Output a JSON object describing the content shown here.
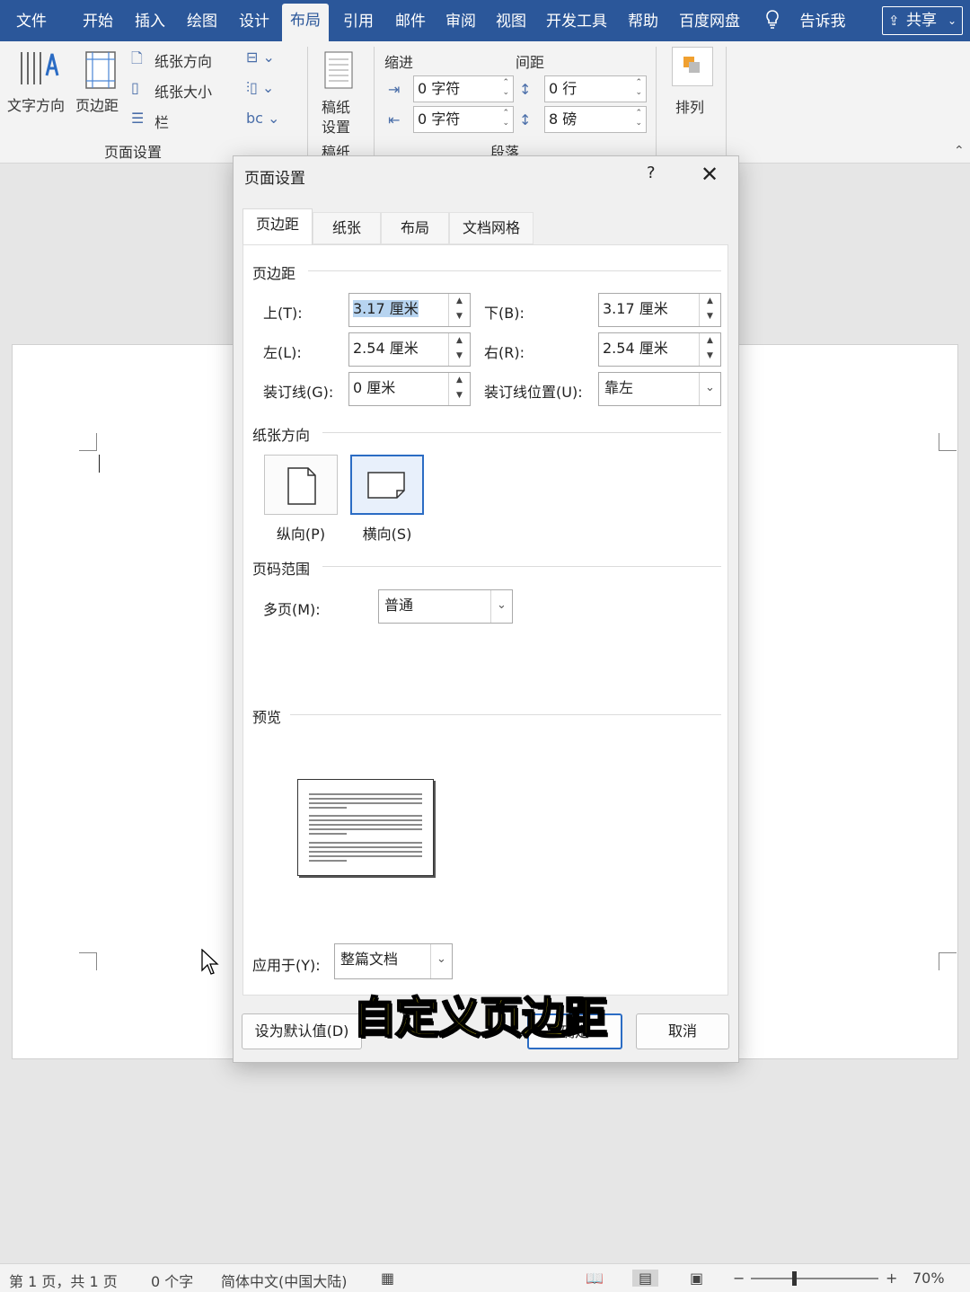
{
  "tabs": [
    "文件",
    "开始",
    "插入",
    "绘图",
    "设计",
    "布局",
    "引用",
    "邮件",
    "审阅",
    "视图",
    "开发工具",
    "帮助",
    "百度网盘"
  ],
  "active_tab": "布局",
  "tell_me": "告诉我",
  "share_label": "共享",
  "ribbon": {
    "text_direction": "文字方向",
    "margins": "页边距",
    "orientation": "纸张方向",
    "size": "纸张大小",
    "columns": "栏",
    "page_setup_group": "页面设置",
    "manuscript_line1": "稿纸",
    "manuscript_line2": "设置",
    "manuscript_group": "稿纸",
    "indent_header": "缩进",
    "spacing_header": "间距",
    "indent_left": "0 字符",
    "indent_right": "0 字符",
    "spacing_before": "0 行",
    "spacing_after": "8 磅",
    "paragraph_group": "段落",
    "arrange": "排列"
  },
  "dialog": {
    "title": "页面设置",
    "help": "?",
    "tabs": [
      "页边距",
      "纸张",
      "布局",
      "文档网格"
    ],
    "margins_section": "页边距",
    "top_label": "上(T):",
    "top_value": "3.17 厘米",
    "bottom_label": "下(B):",
    "bottom_value": "3.17 厘米",
    "left_label": "左(L):",
    "left_value": "2.54 厘米",
    "right_label": "右(R):",
    "right_value": "2.54 厘米",
    "gutter_label": "装订线(G):",
    "gutter_value": "0 厘米",
    "gutter_pos_label": "装订线位置(U):",
    "gutter_pos_value": "靠左",
    "orientation_section": "纸张方向",
    "portrait": "纵向(P)",
    "landscape": "横向(S)",
    "pages_section": "页码范围",
    "multiple_pages_label": "多页(M):",
    "multiple_pages_value": "普通",
    "preview_section": "预览",
    "apply_label": "应用于(Y):",
    "apply_value": "整篇文档",
    "set_default": "设为默认值(D)",
    "ok": "确定",
    "cancel": "取消"
  },
  "caption": "自定义页边距",
  "status": {
    "page": "第 1 页，共 1 页",
    "words": "0 个字",
    "language": "简体中文(中国大陆)",
    "zoom": "70%"
  },
  "colors": {
    "accent": "#2b579a",
    "caption": "#f3e11a"
  }
}
